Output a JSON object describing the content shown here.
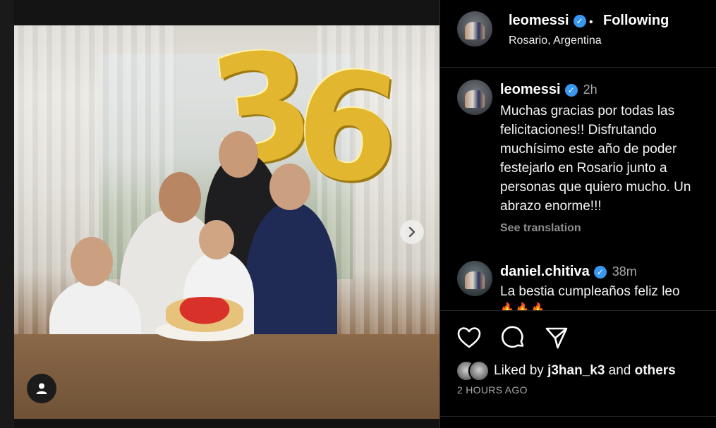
{
  "post": {
    "username": "leomessi",
    "follow_state": "Following",
    "location": "Rosario, Argentina",
    "photo_balloon_1": "3",
    "photo_balloon_2": "6"
  },
  "caption": {
    "username": "leomessi",
    "time": "2h",
    "text": "Muchas gracias por todas las felicitaciones!! Disfrutando muchísimo este año de poder festejarlo en Rosario junto a personas que quiero mucho. Un abrazo enorme!!!",
    "see_translation": "See translation"
  },
  "comment": {
    "username": "daniel.chitiva",
    "time": "38m",
    "text": "La bestia cumpleaños feliz leo",
    "emojis": "🔥🔥🔥"
  },
  "likes": {
    "prefix": "Liked by",
    "user": "j3han_k3",
    "middle": "and",
    "suffix": "others"
  },
  "timestamp": "2 HOURS AGO",
  "icons": {
    "verified": "verified-badge-icon",
    "like": "heart-icon",
    "comment": "comment-bubble-icon",
    "share": "paper-plane-icon",
    "next": "chevron-right-icon",
    "tags": "user-tag-icon"
  },
  "colors": {
    "verified": "#3897f0",
    "background": "#000000"
  }
}
